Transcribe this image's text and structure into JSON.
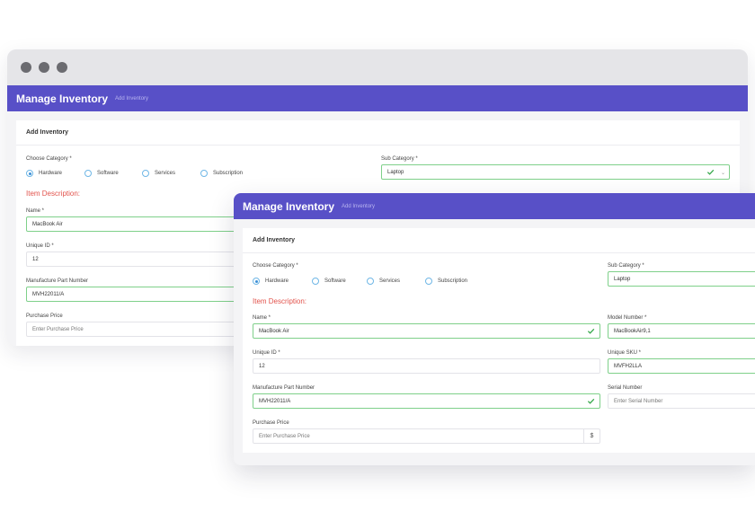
{
  "app": {
    "title": "Manage Inventory",
    "breadcrumb": "Add Inventory"
  },
  "form": {
    "card_title": "Add Inventory",
    "category_label": "Choose Category *",
    "categories": [
      "Hardware",
      "Software",
      "Services",
      "Subscription"
    ],
    "selected_category": "Hardware",
    "subcategory_label": "Sub Category *",
    "subcategory_value": "Laptop",
    "section_title": "Item Description:",
    "name_label": "Name *",
    "name_value": "MacBook Air",
    "model_label": "Model Number *",
    "model_value": "MacBookAir9,1",
    "uid_label": "Unique ID *",
    "uid_value": "12",
    "sku_label": "Unique SKU *",
    "sku_value": "MVFH2LLA",
    "mpn_label": "Manufacture Part Number",
    "mpn_value": "MVH22011/A",
    "serial_label": "Serial Number",
    "serial_placeholder": "Enter Serial Number",
    "price_label": "Purchase Price",
    "price_placeholder": "Enter Purchase Price",
    "currency_symbol": "$"
  },
  "colors": {
    "header": "#5850c7",
    "accent_red": "#e2534c",
    "valid_green": "#7fd08a"
  }
}
